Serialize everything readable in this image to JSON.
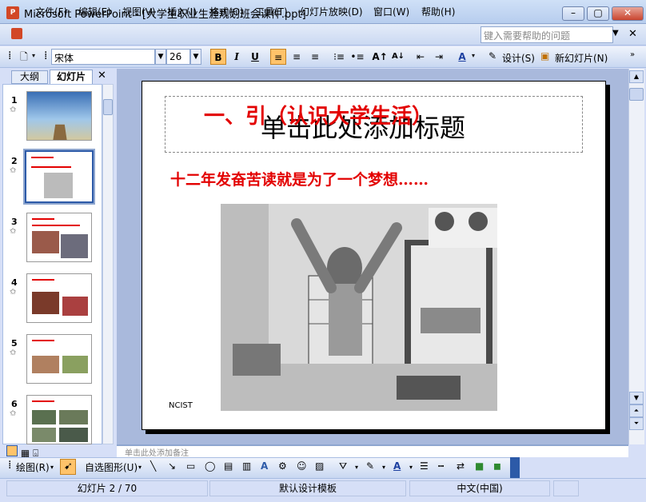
{
  "window": {
    "title": "Microsoft PowerPoint - [大学生职业生涯规划班会课件.ppt]",
    "app_icon": "powerpoint-icon"
  },
  "menu": {
    "items": [
      "文件(F)",
      "编辑(E)",
      "视图(V)",
      "插入(I)",
      "格式(O)",
      "工具(T)",
      "幻灯片放映(D)",
      "窗口(W)",
      "帮助(H)"
    ],
    "help_placeholder": "键入需要帮助的问题"
  },
  "format_toolbar": {
    "font": "宋体",
    "size": "26",
    "bold": "B",
    "italic": "I",
    "underline": "U",
    "design_label": "设计(S)",
    "new_slide_label": "新幻灯片(N)"
  },
  "left_panel": {
    "tab_outline": "大纲",
    "tab_slides": "幻灯片",
    "slides": [
      {
        "num": "1",
        "selected": false
      },
      {
        "num": "2",
        "selected": true
      },
      {
        "num": "3",
        "selected": false
      },
      {
        "num": "4",
        "selected": false
      },
      {
        "num": "5",
        "selected": false
      },
      {
        "num": "6",
        "selected": false
      }
    ]
  },
  "slide": {
    "placeholder_text": "单击此处添加标题",
    "title": "一、引（认识大学生活）",
    "subtitle": "十二年发奋苦读就是为了一个梦想……",
    "footer": "NCIST"
  },
  "notes": {
    "placeholder": "单击此处添加备注"
  },
  "draw_toolbar": {
    "draw_label": "绘图(R)",
    "autoshapes_label": "自选图形(U)"
  },
  "status": {
    "slide_info": "幻灯片 2 / 70",
    "template": "默认设计模板",
    "language": "中文(中国)"
  },
  "colors": {
    "accent": "#e30000",
    "selection": "#ffc36a"
  }
}
